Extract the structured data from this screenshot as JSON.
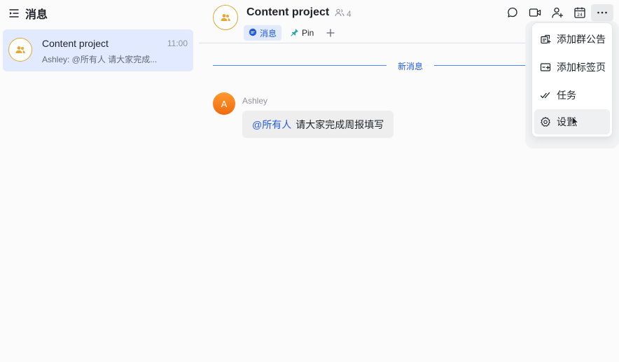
{
  "sidebar": {
    "title": "消息",
    "chats": [
      {
        "name": "Content project",
        "time": "11:00",
        "preview": "Ashley: @所有人 请大家完成..."
      }
    ]
  },
  "chat": {
    "title": "Content project",
    "member_count": "4",
    "tabs": [
      {
        "label": "消息",
        "active": true
      },
      {
        "label": "Pin",
        "active": false
      }
    ],
    "toolbar_icons": [
      "search-chat-icon",
      "video-call-icon",
      "add-member-icon",
      "calendar-icon",
      "more-icon"
    ],
    "calendar_day": "24",
    "new_messages_label": "新消息",
    "messages": [
      {
        "avatar_letter": "A",
        "sender": "Ashley",
        "mention": "@所有人",
        "text": "请大家完成周报填写"
      }
    ]
  },
  "menu": {
    "items": [
      {
        "label": "添加群公告",
        "icon": "announcement-icon"
      },
      {
        "label": "添加标签页",
        "icon": "add-tab-icon"
      },
      {
        "label": "任务",
        "icon": "task-icon"
      },
      {
        "label": "设置",
        "icon": "settings-icon",
        "hovered": true
      }
    ]
  },
  "colors": {
    "accent": "#245bdb",
    "selected_bg": "#e1eaff",
    "avatar_ring": "#e2a83b",
    "user_avatar": "#f47b1a"
  }
}
